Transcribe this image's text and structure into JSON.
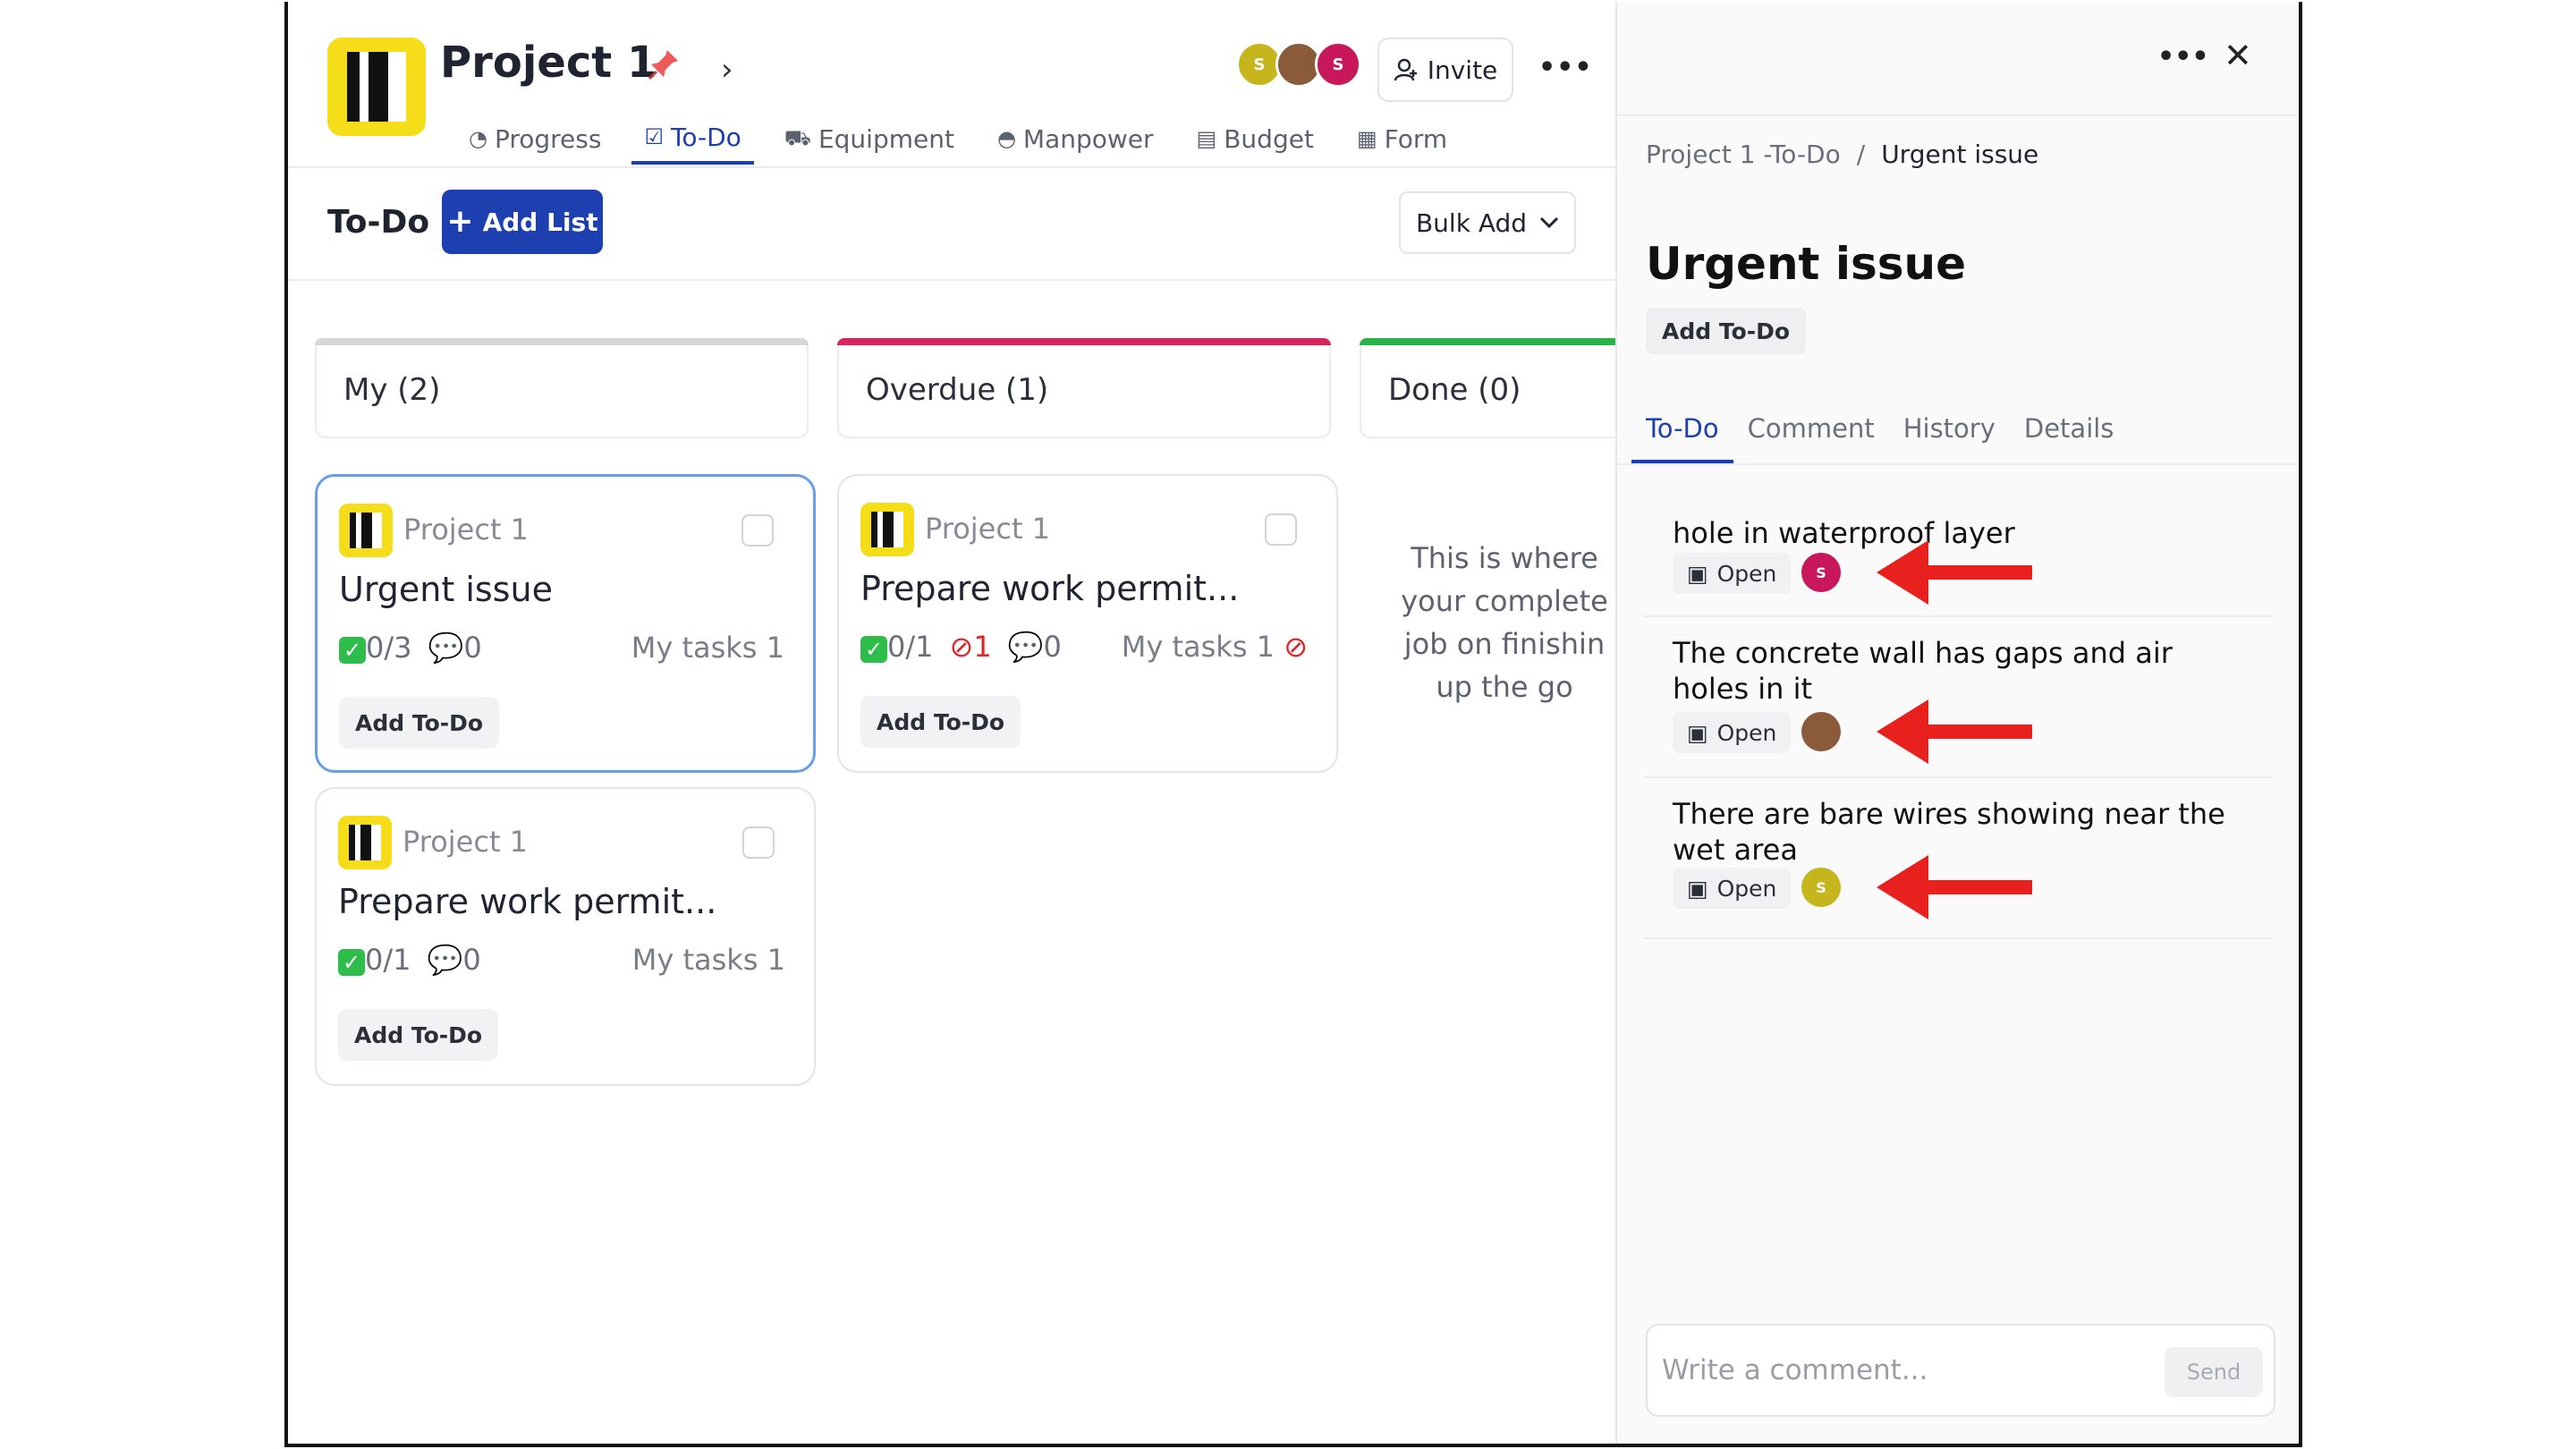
{
  "header": {
    "project_title": "Project 1",
    "invite_label": "Invite",
    "avatars": [
      {
        "initial": "S",
        "color": "#c6b51c"
      },
      {
        "initial": "",
        "color": "#8a5a3a"
      },
      {
        "initial": "S",
        "color": "#c8175a"
      }
    ]
  },
  "tabs": [
    {
      "label": "Progress",
      "icon": "gauge-icon"
    },
    {
      "label": "To-Do",
      "icon": "clipboard-icon",
      "active": true
    },
    {
      "label": "Equipment",
      "icon": "truck-icon"
    },
    {
      "label": "Manpower",
      "icon": "helmet-icon"
    },
    {
      "label": "Budget",
      "icon": "ledger-icon"
    },
    {
      "label": "Form",
      "icon": "table-icon"
    }
  ],
  "toolbar": {
    "todo_label": "To-Do",
    "add_list_label": "Add List",
    "bulk_add_label": "Bulk Add"
  },
  "columns": [
    {
      "title": "My (2)",
      "bar_color": "#d6d6da"
    },
    {
      "title": "Overdue (1)",
      "bar_color": "#d8245c"
    },
    {
      "title": "Done (0)",
      "bar_color": "#2cb24a"
    }
  ],
  "cards": [
    {
      "project": "Project 1",
      "title": "Urgent issue",
      "progress": "0/3",
      "comments": "0",
      "overdue": "",
      "my_tasks": "My tasks 1",
      "add_label": "Add To-Do"
    },
    {
      "project": "Project 1",
      "title": "Prepare work permit...",
      "progress": "0/1",
      "comments": "0",
      "overdue": "1",
      "my_tasks": "My tasks 1",
      "add_label": "Add To-Do"
    },
    {
      "project": "Project 1",
      "title": "Prepare work permit...",
      "progress": "0/1",
      "comments": "0",
      "overdue": "",
      "my_tasks": "My tasks 1",
      "add_label": "Add To-Do"
    }
  ],
  "done_description": [
    "This is where",
    "your complete",
    "job on finishin",
    "up the go"
  ],
  "panel": {
    "breadcrumb_parent": "Project 1 -To-Do",
    "breadcrumb_sep": "/",
    "breadcrumb_current": "Urgent issue",
    "title": "Urgent issue",
    "add_todo_label": "Add To-Do",
    "tabs": [
      "To-Do",
      "Comment",
      "History",
      "Details"
    ],
    "issues": [
      {
        "text": "hole in waterproof layer",
        "status": "Open",
        "avatar_initial": "S",
        "avatar_color": "#c8175a"
      },
      {
        "text": "The concrete wall has gaps and air holes in it",
        "status": "Open",
        "avatar_initial": "",
        "avatar_color": "#8a5a3a"
      },
      {
        "text": "There are bare wires showing near the wet area",
        "status": "Open",
        "avatar_initial": "S",
        "avatar_color": "#c6b51c"
      }
    ],
    "comment_placeholder": "Write a comment...",
    "send_label": "Send"
  },
  "colors": {
    "accent": "#1d3fb0",
    "brand_yellow": "#f6dd1a",
    "arrow_red": "#e8211f"
  }
}
